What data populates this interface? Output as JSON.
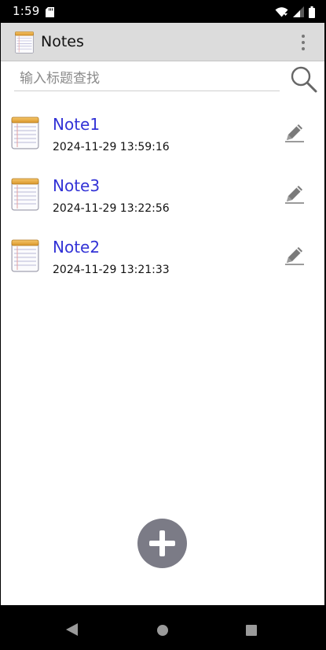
{
  "status_bar": {
    "time": "1:59",
    "icons": [
      "sd-card-icon",
      "wifi-icon",
      "signal-icon",
      "battery-icon"
    ]
  },
  "app_bar": {
    "title": "Notes",
    "logo_icon": "notepad-icon",
    "menu_icon": "overflow-menu-icon"
  },
  "search": {
    "placeholder": "输入标题查找",
    "value": "",
    "button_icon": "search-icon"
  },
  "notes": [
    {
      "title": "Note1",
      "date": "2024-11-29 13:59:16"
    },
    {
      "title": "Note3",
      "date": "2024-11-29 13:22:56"
    },
    {
      "title": "Note2",
      "date": "2024-11-29 13:21:33"
    }
  ],
  "fab": {
    "icon": "add-icon"
  },
  "nav_bar": {
    "icons": [
      "back-icon",
      "home-icon",
      "recents-icon"
    ]
  },
  "colors": {
    "action_bar": "#dcdcdc",
    "note_title": "#3333d6",
    "fab": "#7b7b86",
    "icon_gray": "#777777"
  }
}
